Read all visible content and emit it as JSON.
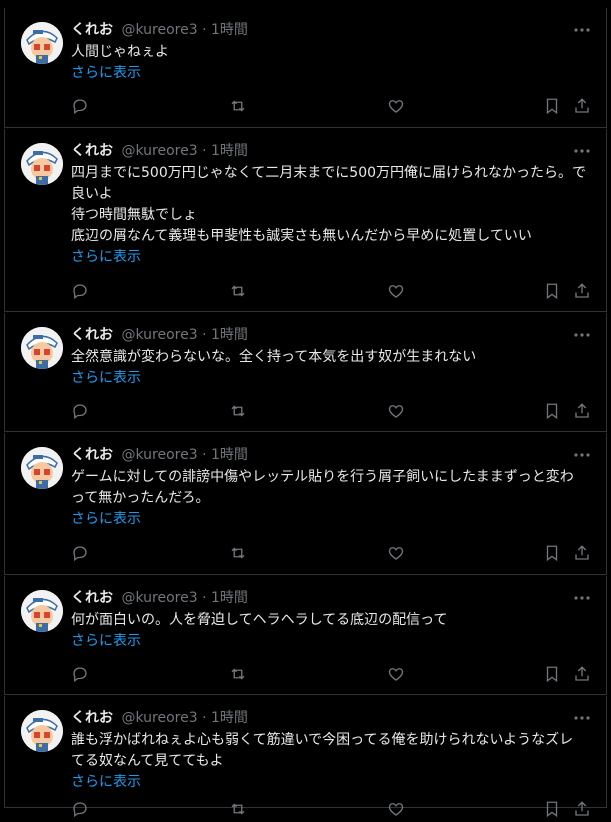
{
  "tweets": [
    {
      "name": "くれお",
      "handle": "@kureore3",
      "sep": "·",
      "time": "1時間",
      "lines": [
        "人間じゃねぇよ"
      ],
      "more": "さらに表示"
    },
    {
      "name": "くれお",
      "handle": "@kureore3",
      "sep": "·",
      "time": "1時間",
      "lines": [
        "四月までに500万円じゃなくて二月末までに500万円俺に届けられなかったら。で良いよ",
        "待つ時間無駄でしょ",
        "底辺の屑なんて義理も甲斐性も誠実さも無いんだから早めに処置していい"
      ],
      "more": "さらに表示"
    },
    {
      "name": "くれお",
      "handle": "@kureore3",
      "sep": "·",
      "time": "1時間",
      "lines": [
        "全然意識が変わらないな。全く持って本気を出す奴が生まれない"
      ],
      "more": "さらに表示"
    },
    {
      "name": "くれお",
      "handle": "@kureore3",
      "sep": "·",
      "time": "1時間",
      "lines": [
        "ゲームに対しての誹謗中傷やレッテル貼りを行う屑子飼いにしたままずっと変わって無かったんだろ。"
      ],
      "more": "さらに表示"
    },
    {
      "name": "くれお",
      "handle": "@kureore3",
      "sep": "·",
      "time": "1時間",
      "lines": [
        "何が面白いの。人を脅迫してヘラヘラしてる底辺の配信って"
      ],
      "more": "さらに表示"
    },
    {
      "name": "くれお",
      "handle": "@kureore3",
      "sep": "·",
      "time": "1時間",
      "lines": [
        "誰も浮かばれねぇよ心も弱くて筋違いで今困ってる俺を助けられないようなズレてる奴なんて見ててもよ"
      ],
      "more": "さらに表示"
    }
  ],
  "icons": {
    "reply": "reply-icon",
    "retweet": "retweet-icon",
    "like": "like-icon",
    "bookmark": "bookmark-icon",
    "share": "share-icon",
    "more": "more-icon"
  },
  "colors": {
    "background": "#000000",
    "text": "#e7e9ea",
    "secondary": "#71767b",
    "link": "#1d9bf0",
    "divider": "#2f3336"
  }
}
